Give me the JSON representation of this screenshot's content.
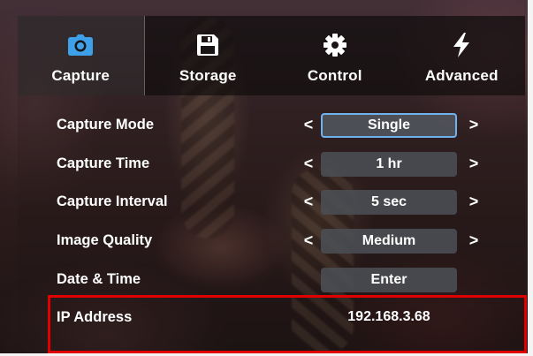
{
  "tabs": [
    {
      "label": "Capture",
      "icon": "camera-icon",
      "active": true
    },
    {
      "label": "Storage",
      "icon": "floppy-disk-icon",
      "active": false
    },
    {
      "label": "Control",
      "icon": "gear-icon",
      "active": false
    },
    {
      "label": "Advanced",
      "icon": "lightning-bolt-icon",
      "active": false
    }
  ],
  "settings": {
    "capture_mode": {
      "label": "Capture Mode",
      "value": "Single"
    },
    "capture_time": {
      "label": "Capture Time",
      "value": "1 hr"
    },
    "capture_interval": {
      "label": "Capture Interval",
      "value": "5 sec"
    },
    "image_quality": {
      "label": "Image Quality",
      "value": "Medium"
    },
    "date_time": {
      "label": "Date & Time",
      "value": "Enter"
    },
    "ip_address": {
      "label": "IP Address",
      "value": "192.168.3.68"
    }
  },
  "arrows": {
    "left": "<",
    "right": ">"
  },
  "colors": {
    "accent_tab_icon": "#3ea0e8",
    "selected_border": "#6fb3ee",
    "highlight_box": "#e00000"
  }
}
